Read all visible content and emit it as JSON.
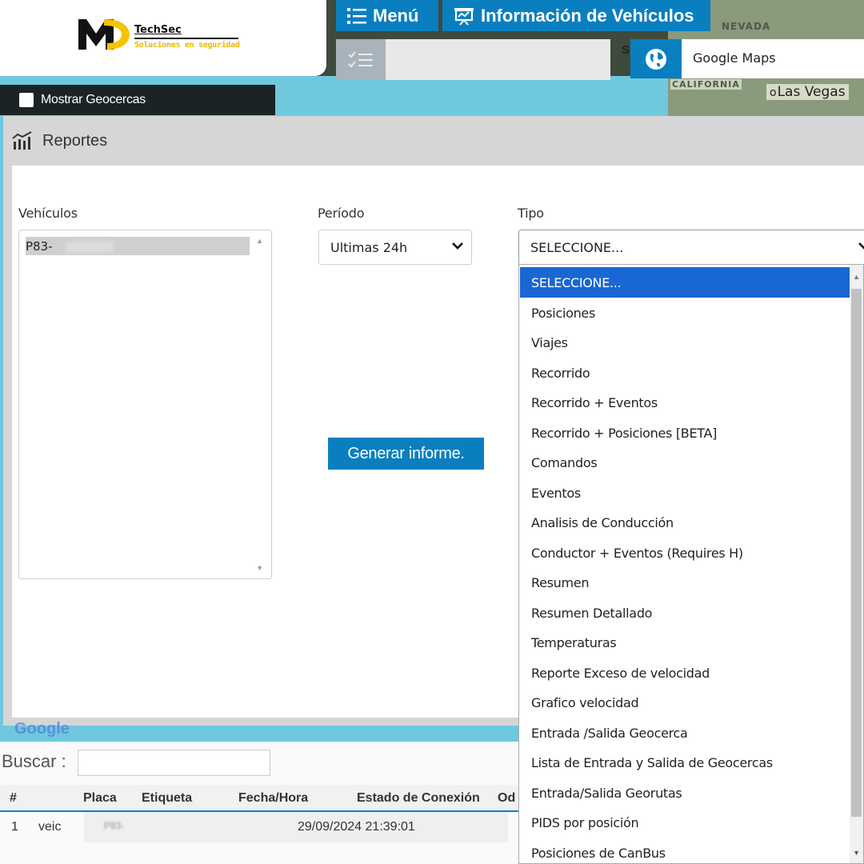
{
  "brand": {
    "name": "TechSec",
    "tagline": "Soluciones en seguridad",
    "colors": {
      "primary": "#0a7fc0",
      "accent": "#f5c400",
      "dark": "#1b2325"
    }
  },
  "map": {
    "labels": {
      "nevada": "NEVADA",
      "california": "CALIFORNIA",
      "lasvegas": "Las Vegas"
    },
    "google_logo": "Google"
  },
  "toolbar": {
    "menu_label": "Menú",
    "menu_icon": "list-icon",
    "info_label": "Información de Vehículos",
    "info_icon": "presentation-icon",
    "filter_icon": "checklist-icon",
    "search_letter": "S",
    "map_icon": "globe-icon",
    "map_provider": "Google Maps"
  },
  "geocercas": {
    "label": "Mostrar Geocercas",
    "checked": false
  },
  "reportes": {
    "title": "Reportes",
    "icon": "bar-chart-icon",
    "vehiculos": {
      "label": "Vehículos",
      "items": [
        "P83-"
      ]
    },
    "periodo": {
      "label": "Período",
      "value": "Ultimas 24h"
    },
    "tipo": {
      "label": "Tipo",
      "value": "SELECCIONE...",
      "options": [
        "SELECCIONE...",
        "Posiciones",
        "Viajes",
        "Recorrido",
        "Recorrido + Eventos",
        "Recorrido + Posiciones [BETA]",
        "Comandos",
        "Eventos",
        "Analisis de Conducción",
        "Conductor + Eventos (Requires H)",
        "Resumen",
        "Resumen Detallado",
        "Temperaturas",
        "Reporte Exceso de velocidad",
        "Grafico velocidad",
        "Entrada /Salida Geocerca",
        "Lista de Entrada y Salida de Geocercas",
        "Entrada/Salida Georutas",
        "PIDS por posición",
        "Posiciones de CanBus"
      ]
    },
    "generate_label": "Generar informe."
  },
  "table": {
    "search_label": "Buscar :",
    "search_value": "",
    "columns": [
      "#",
      "Placa",
      "Etiqueta",
      "Fecha/Hora",
      "Estado de Conexión",
      "Od"
    ],
    "rows": [
      {
        "num": "1",
        "tipo": "veic",
        "placa": "P83-",
        "fecha": "29/09/2024 21:39:01"
      }
    ]
  }
}
